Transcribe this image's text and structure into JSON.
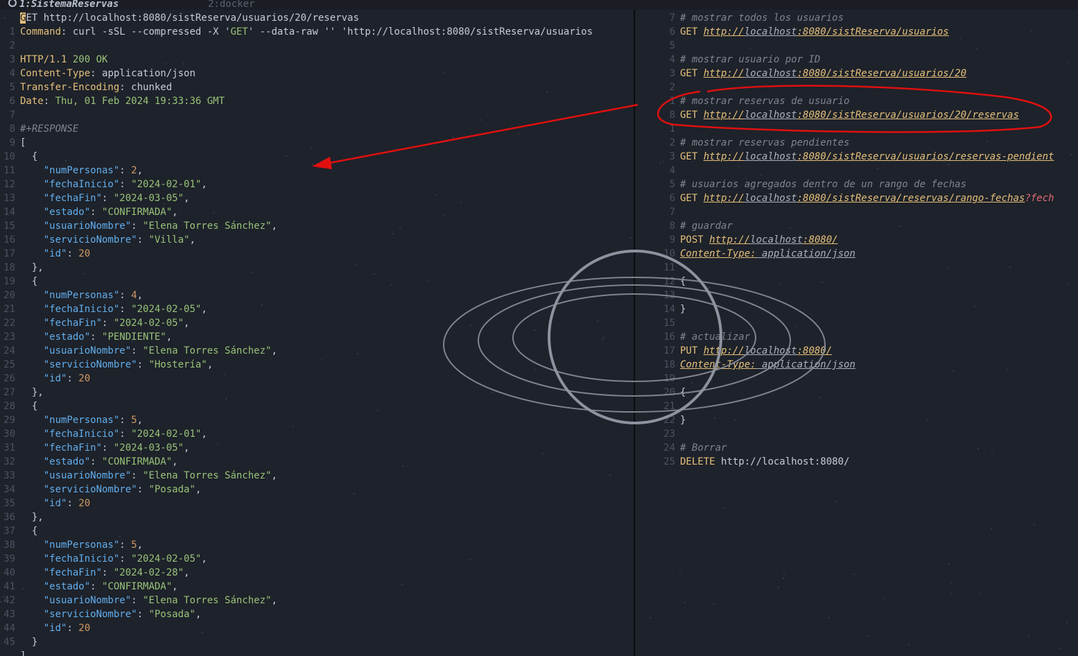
{
  "tabs": [
    {
      "label": "1:SistemaReservas"
    },
    {
      "label": "2:docker"
    }
  ],
  "left_lines": [
    {
      "n": "",
      "parts": [
        [
          "cursor",
          "G"
        ],
        [
          "plain",
          "ET http://localhost:8080/sistReserva/usuarios/20/reservas"
        ]
      ]
    },
    {
      "n": "1",
      "parts": [
        [
          "hdr",
          "Command"
        ],
        [
          "plain",
          ": curl -sSL --compressed -X '"
        ],
        [
          "s",
          "GET"
        ],
        [
          "plain",
          "' --data-raw '' 'http://localhost:8080/sistReserva/usuarios"
        ]
      ]
    },
    {
      "n": "2",
      "parts": []
    },
    {
      "n": "3",
      "parts": [
        [
          "hdr",
          "HTTP/1.1 "
        ],
        [
          "s",
          "200 OK"
        ]
      ]
    },
    {
      "n": "4",
      "parts": [
        [
          "hdr",
          "Content-Type"
        ],
        [
          "plain",
          ": application/json"
        ]
      ]
    },
    {
      "n": "5",
      "parts": [
        [
          "hdr",
          "Transfer-Encoding"
        ],
        [
          "plain",
          ": chunked"
        ]
      ]
    },
    {
      "n": "6",
      "parts": [
        [
          "hdr",
          "Date"
        ],
        [
          "plain",
          ": "
        ],
        [
          "s",
          "Thu, 01 Feb 2024 19:33:36 GMT"
        ]
      ]
    },
    {
      "n": "7",
      "parts": []
    },
    {
      "n": "8",
      "parts": [
        [
          "com",
          "#+RESPONSE"
        ]
      ]
    },
    {
      "n": "9",
      "parts": [
        [
          "plain",
          "["
        ]
      ]
    },
    {
      "n": "10",
      "parts": [
        [
          "plain",
          "  {"
        ]
      ]
    },
    {
      "n": "11",
      "parts": [
        [
          "plain",
          "    "
        ],
        [
          "key",
          "\"numPersonas\""
        ],
        [
          "plain",
          ": "
        ],
        [
          "num",
          "2"
        ],
        [
          "plain",
          ","
        ]
      ]
    },
    {
      "n": "12",
      "parts": [
        [
          "plain",
          "    "
        ],
        [
          "key",
          "\"fechaInicio\""
        ],
        [
          "plain",
          ": "
        ],
        [
          "s",
          "\"2024-02-01\""
        ],
        [
          "plain",
          ","
        ]
      ]
    },
    {
      "n": "13",
      "parts": [
        [
          "plain",
          "    "
        ],
        [
          "key",
          "\"fechaFin\""
        ],
        [
          "plain",
          ": "
        ],
        [
          "s",
          "\"2024-03-05\""
        ],
        [
          "plain",
          ","
        ]
      ]
    },
    {
      "n": "14",
      "parts": [
        [
          "plain",
          "    "
        ],
        [
          "key",
          "\"estado\""
        ],
        [
          "plain",
          ": "
        ],
        [
          "s",
          "\"CONFIRMADA\""
        ],
        [
          "plain",
          ","
        ]
      ]
    },
    {
      "n": "15",
      "parts": [
        [
          "plain",
          "    "
        ],
        [
          "key",
          "\"usuarioNombre\""
        ],
        [
          "plain",
          ": "
        ],
        [
          "s",
          "\"Elena Torres Sánchez\""
        ],
        [
          "plain",
          ","
        ]
      ]
    },
    {
      "n": "16",
      "parts": [
        [
          "plain",
          "    "
        ],
        [
          "key",
          "\"servicioNombre\""
        ],
        [
          "plain",
          ": "
        ],
        [
          "s",
          "\"Villa\""
        ],
        [
          "plain",
          ","
        ]
      ]
    },
    {
      "n": "17",
      "parts": [
        [
          "plain",
          "    "
        ],
        [
          "key",
          "\"id\""
        ],
        [
          "plain",
          ": "
        ],
        [
          "num",
          "20"
        ]
      ]
    },
    {
      "n": "18",
      "parts": [
        [
          "plain",
          "  },"
        ]
      ]
    },
    {
      "n": "19",
      "parts": [
        [
          "plain",
          "  {"
        ]
      ]
    },
    {
      "n": "20",
      "parts": [
        [
          "plain",
          "    "
        ],
        [
          "key",
          "\"numPersonas\""
        ],
        [
          "plain",
          ": "
        ],
        [
          "num",
          "4"
        ],
        [
          "plain",
          ","
        ]
      ]
    },
    {
      "n": "21",
      "parts": [
        [
          "plain",
          "    "
        ],
        [
          "key",
          "\"fechaInicio\""
        ],
        [
          "plain",
          ": "
        ],
        [
          "s",
          "\"2024-02-05\""
        ],
        [
          "plain",
          ","
        ]
      ]
    },
    {
      "n": "22",
      "parts": [
        [
          "plain",
          "    "
        ],
        [
          "key",
          "\"fechaFin\""
        ],
        [
          "plain",
          ": "
        ],
        [
          "s",
          "\"2024-02-05\""
        ],
        [
          "plain",
          ","
        ]
      ]
    },
    {
      "n": "23",
      "parts": [
        [
          "plain",
          "    "
        ],
        [
          "key",
          "\"estado\""
        ],
        [
          "plain",
          ": "
        ],
        [
          "s",
          "\"PENDIENTE\""
        ],
        [
          "plain",
          ","
        ]
      ]
    },
    {
      "n": "24",
      "parts": [
        [
          "plain",
          "    "
        ],
        [
          "key",
          "\"usuarioNombre\""
        ],
        [
          "plain",
          ": "
        ],
        [
          "s",
          "\"Elena Torres Sánchez\""
        ],
        [
          "plain",
          ","
        ]
      ]
    },
    {
      "n": "25",
      "parts": [
        [
          "plain",
          "    "
        ],
        [
          "key",
          "\"servicioNombre\""
        ],
        [
          "plain",
          ": "
        ],
        [
          "s",
          "\"Hostería\""
        ],
        [
          "plain",
          ","
        ]
      ]
    },
    {
      "n": "26",
      "parts": [
        [
          "plain",
          "    "
        ],
        [
          "key",
          "\"id\""
        ],
        [
          "plain",
          ": "
        ],
        [
          "num",
          "20"
        ]
      ]
    },
    {
      "n": "27",
      "parts": [
        [
          "plain",
          "  },"
        ]
      ]
    },
    {
      "n": "28",
      "parts": [
        [
          "plain",
          "  {"
        ]
      ]
    },
    {
      "n": "29",
      "parts": [
        [
          "plain",
          "    "
        ],
        [
          "key",
          "\"numPersonas\""
        ],
        [
          "plain",
          ": "
        ],
        [
          "num",
          "5"
        ],
        [
          "plain",
          ","
        ]
      ]
    },
    {
      "n": "30",
      "parts": [
        [
          "plain",
          "    "
        ],
        [
          "key",
          "\"fechaInicio\""
        ],
        [
          "plain",
          ": "
        ],
        [
          "s",
          "\"2024-02-01\""
        ],
        [
          "plain",
          ","
        ]
      ]
    },
    {
      "n": "31",
      "parts": [
        [
          "plain",
          "    "
        ],
        [
          "key",
          "\"fechaFin\""
        ],
        [
          "plain",
          ": "
        ],
        [
          "s",
          "\"2024-03-05\""
        ],
        [
          "plain",
          ","
        ]
      ]
    },
    {
      "n": "32",
      "parts": [
        [
          "plain",
          "    "
        ],
        [
          "key",
          "\"estado\""
        ],
        [
          "plain",
          ": "
        ],
        [
          "s",
          "\"CONFIRMADA\""
        ],
        [
          "plain",
          ","
        ]
      ]
    },
    {
      "n": "33",
      "parts": [
        [
          "plain",
          "    "
        ],
        [
          "key",
          "\"usuarioNombre\""
        ],
        [
          "plain",
          ": "
        ],
        [
          "s",
          "\"Elena Torres Sánchez\""
        ],
        [
          "plain",
          ","
        ]
      ]
    },
    {
      "n": "34",
      "parts": [
        [
          "plain",
          "    "
        ],
        [
          "key",
          "\"servicioNombre\""
        ],
        [
          "plain",
          ": "
        ],
        [
          "s",
          "\"Posada\""
        ],
        [
          "plain",
          ","
        ]
      ]
    },
    {
      "n": "35",
      "parts": [
        [
          "plain",
          "    "
        ],
        [
          "key",
          "\"id\""
        ],
        [
          "plain",
          ": "
        ],
        [
          "num",
          "20"
        ]
      ]
    },
    {
      "n": "36",
      "parts": [
        [
          "plain",
          "  },"
        ]
      ]
    },
    {
      "n": "37",
      "parts": [
        [
          "plain",
          "  {"
        ]
      ]
    },
    {
      "n": "38",
      "parts": [
        [
          "plain",
          "    "
        ],
        [
          "key",
          "\"numPersonas\""
        ],
        [
          "plain",
          ": "
        ],
        [
          "num",
          "5"
        ],
        [
          "plain",
          ","
        ]
      ]
    },
    {
      "n": "39",
      "parts": [
        [
          "plain",
          "    "
        ],
        [
          "key",
          "\"fechaInicio\""
        ],
        [
          "plain",
          ": "
        ],
        [
          "s",
          "\"2024-02-05\""
        ],
        [
          "plain",
          ","
        ]
      ]
    },
    {
      "n": "40",
      "parts": [
        [
          "plain",
          "    "
        ],
        [
          "key",
          "\"fechaFin\""
        ],
        [
          "plain",
          ": "
        ],
        [
          "s",
          "\"2024-02-28\""
        ],
        [
          "plain",
          ","
        ]
      ]
    },
    {
      "n": "41",
      "parts": [
        [
          "plain",
          "    "
        ],
        [
          "key",
          "\"estado\""
        ],
        [
          "plain",
          ": "
        ],
        [
          "s",
          "\"CONFIRMADA\""
        ],
        [
          "plain",
          ","
        ]
      ]
    },
    {
      "n": "42",
      "parts": [
        [
          "plain",
          "    "
        ],
        [
          "key",
          "\"usuarioNombre\""
        ],
        [
          "plain",
          ": "
        ],
        [
          "s",
          "\"Elena Torres Sánchez\""
        ],
        [
          "plain",
          ","
        ]
      ]
    },
    {
      "n": "43",
      "parts": [
        [
          "plain",
          "    "
        ],
        [
          "key",
          "\"servicioNombre\""
        ],
        [
          "plain",
          ": "
        ],
        [
          "s",
          "\"Posada\""
        ],
        [
          "plain",
          ","
        ]
      ]
    },
    {
      "n": "44",
      "parts": [
        [
          "plain",
          "    "
        ],
        [
          "key",
          "\"id\""
        ],
        [
          "plain",
          ": "
        ],
        [
          "num",
          "20"
        ]
      ]
    },
    {
      "n": "45",
      "parts": [
        [
          "plain",
          "  }"
        ]
      ]
    },
    {
      "n": "",
      "parts": [
        [
          "plain",
          "]"
        ]
      ]
    }
  ],
  "right_lines": [
    {
      "n": "7",
      "parts": [
        [
          "com",
          "# mostrar todos los usuarios"
        ]
      ]
    },
    {
      "n": "6",
      "parts": [
        [
          "meth",
          "GET "
        ],
        [
          "url",
          "http://"
        ],
        [
          "urlh",
          "localhost"
        ],
        [
          "url",
          ":8080/sistReserva/usuarios"
        ]
      ]
    },
    {
      "n": "5",
      "parts": []
    },
    {
      "n": "4",
      "parts": [
        [
          "com",
          "# mostrar usuario por ID"
        ]
      ]
    },
    {
      "n": "3",
      "parts": [
        [
          "meth",
          "GET "
        ],
        [
          "url",
          "http://"
        ],
        [
          "urlh",
          "localhost"
        ],
        [
          "url",
          ":8080/sistReserva/usuarios/20"
        ]
      ]
    },
    {
      "n": "2",
      "parts": []
    },
    {
      "n": "1",
      "parts": [
        [
          "com",
          "# mostrar reservas de usuario"
        ]
      ]
    },
    {
      "n": "8",
      "parts": [
        [
          "meth",
          "GET "
        ],
        [
          "url",
          "http://"
        ],
        [
          "urlh",
          "localhost"
        ],
        [
          "url",
          ":8080/sistReserva/usuarios/20/reservas"
        ]
      ]
    },
    {
      "n": "1",
      "parts": []
    },
    {
      "n": "2",
      "parts": [
        [
          "com",
          "# mostrar reservas pendientes"
        ]
      ]
    },
    {
      "n": "3",
      "parts": [
        [
          "meth",
          "GET "
        ],
        [
          "url",
          "http://"
        ],
        [
          "urlh",
          "localhost"
        ],
        [
          "url",
          ":8080/sistReserva/usuarios/reservas-pendient"
        ]
      ]
    },
    {
      "n": "4",
      "parts": []
    },
    {
      "n": "5",
      "parts": [
        [
          "com",
          "# usuarios agregados dentro de un rango de fechas"
        ]
      ]
    },
    {
      "n": "6",
      "parts": [
        [
          "meth",
          "GET "
        ],
        [
          "url",
          "http://"
        ],
        [
          "urlh",
          "localhost"
        ],
        [
          "url",
          ":8080/sistReserva/reservas/rango-fechas"
        ],
        [
          "ell",
          "?fech"
        ]
      ]
    },
    {
      "n": "7",
      "parts": []
    },
    {
      "n": "8",
      "parts": [
        [
          "com",
          "# guardar"
        ]
      ]
    },
    {
      "n": "9",
      "parts": [
        [
          "meth",
          "POST "
        ],
        [
          "url",
          "http://"
        ],
        [
          "urlh",
          "localhost"
        ],
        [
          "url",
          ":8080/"
        ]
      ]
    },
    {
      "n": "10",
      "parts": [
        [
          "url",
          "Content-Type:"
        ],
        [
          "urlh",
          " application/json"
        ]
      ]
    },
    {
      "n": "11",
      "parts": []
    },
    {
      "n": "12",
      "parts": [
        [
          "plain",
          "{"
        ]
      ]
    },
    {
      "n": "13",
      "parts": []
    },
    {
      "n": "14",
      "parts": [
        [
          "plain",
          "}"
        ]
      ]
    },
    {
      "n": "15",
      "parts": []
    },
    {
      "n": "16",
      "parts": [
        [
          "com",
          "# actualizar"
        ]
      ]
    },
    {
      "n": "17",
      "parts": [
        [
          "meth",
          "PUT "
        ],
        [
          "url",
          "http://"
        ],
        [
          "urlh",
          "localhost"
        ],
        [
          "url",
          ":8080/"
        ]
      ]
    },
    {
      "n": "18",
      "parts": [
        [
          "url",
          "Content-Type:"
        ],
        [
          "urlh",
          " application/json"
        ]
      ]
    },
    {
      "n": "19",
      "parts": []
    },
    {
      "n": "20",
      "parts": [
        [
          "plain",
          "{"
        ]
      ]
    },
    {
      "n": "21",
      "parts": []
    },
    {
      "n": "22",
      "parts": [
        [
          "plain",
          "}"
        ]
      ]
    },
    {
      "n": "23",
      "parts": []
    },
    {
      "n": "24",
      "parts": [
        [
          "com",
          "# Borrar"
        ]
      ]
    },
    {
      "n": "25",
      "parts": [
        [
          "meth",
          "DELETE "
        ],
        [
          "plain",
          "http://localhost:8080/"
        ]
      ]
    }
  ]
}
